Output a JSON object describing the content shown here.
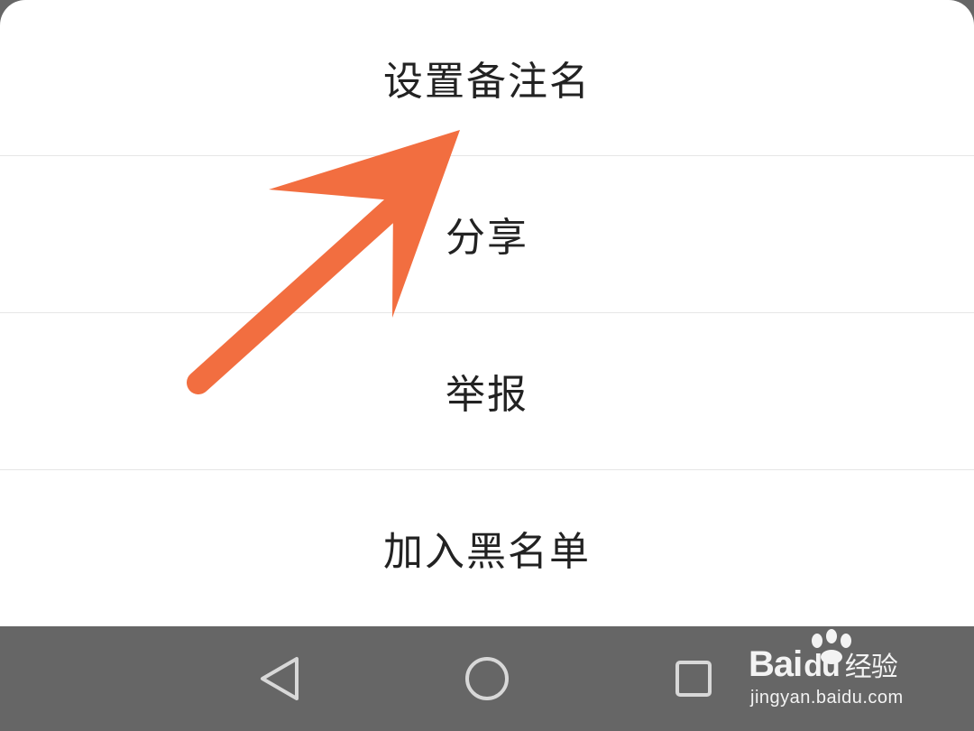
{
  "menu": {
    "items": [
      {
        "label": "设置备注名"
      },
      {
        "label": "分享"
      },
      {
        "label": "举报"
      },
      {
        "label": "加入黑名单"
      }
    ]
  },
  "navbar": {
    "back_icon": "triangle-back-icon",
    "home_icon": "circle-home-icon",
    "recents_icon": "square-recents-icon"
  },
  "annotation": {
    "arrow_color": "#f26e40",
    "points_to": "设置备注名"
  },
  "watermark": {
    "brand_bai": "Bai",
    "brand_du": "du",
    "brand_jingyan": "经验",
    "url": "jingyan.baidu.com"
  },
  "colors": {
    "sheet_bg": "#ffffff",
    "navbar_bg": "#666666",
    "text": "#222222",
    "divider": "#e6e6e6",
    "arrow": "#f26e40"
  }
}
